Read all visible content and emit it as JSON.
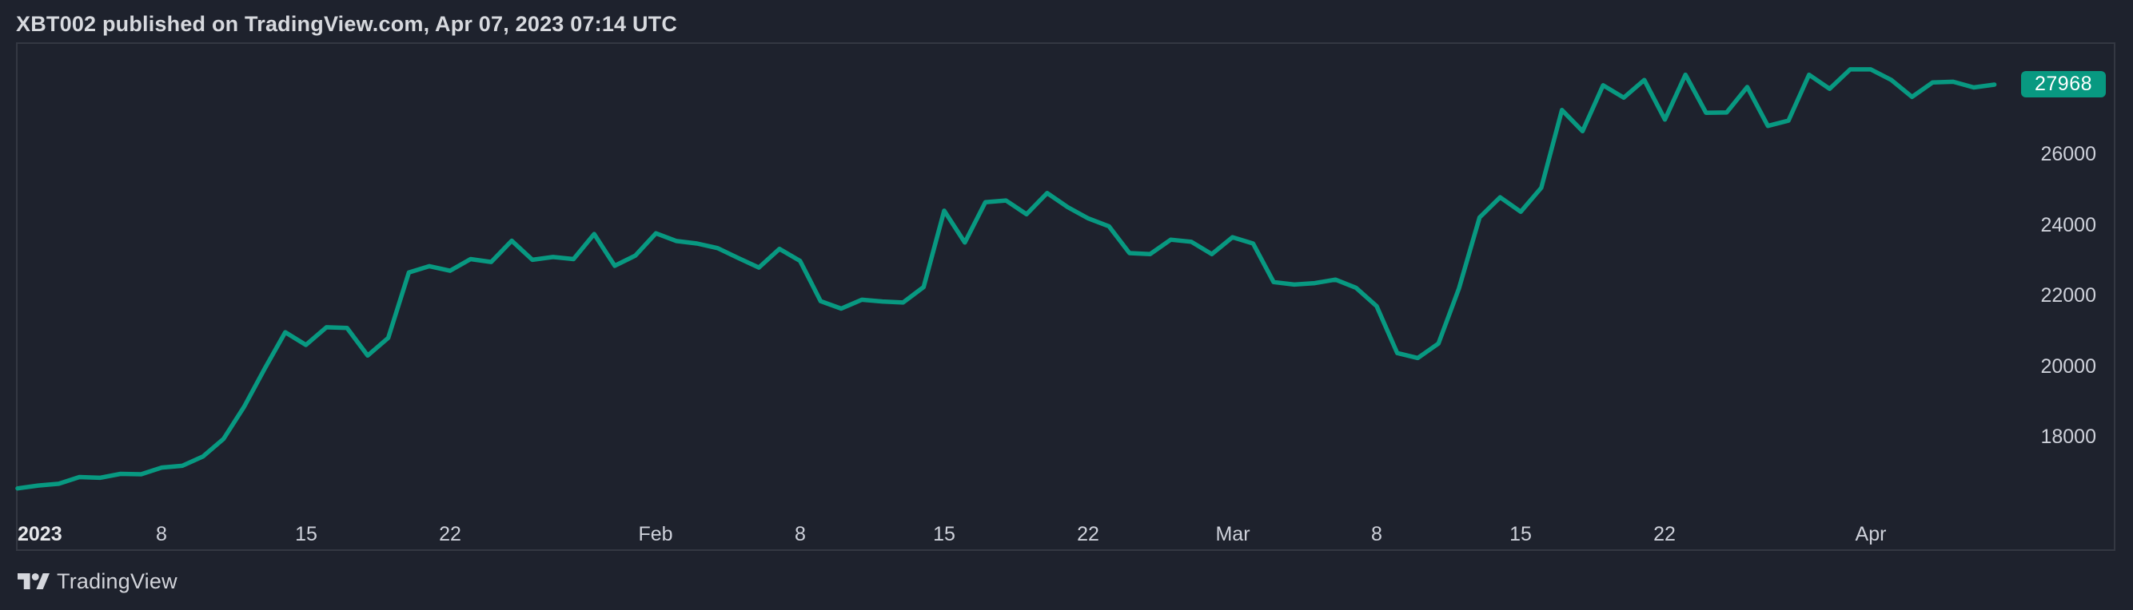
{
  "header": {
    "title": "XBT002 published on TradingView.com, Apr 07, 2023 07:14 UTC"
  },
  "price_label": {
    "value": "27968"
  },
  "footer": {
    "brand": "TradingView",
    "logo_icon": "tradingview-logo"
  },
  "colors": {
    "accent": "#089981",
    "background": "#1e222d",
    "border": "#343842",
    "axis_text": "#ced1da",
    "title_text": "#d7d9de",
    "badge_text": "#ffffff"
  },
  "chart_data": {
    "type": "line",
    "title": "XBT002 published on TradingView.com, Apr 07, 2023 07:14 UTC",
    "symbol": "XBT002",
    "timeframe": "1D",
    "x_start_date": "2023-01-01",
    "x_end_date": "2023-04-07",
    "last_price": 27968,
    "line_color": "#089981",
    "grid": false,
    "legend_position": "none",
    "y_ticks": [
      26000,
      24000,
      22000,
      20000,
      18000
    ],
    "ylim": [
      14700,
      29200
    ],
    "x_ticks": [
      {
        "label": "2023",
        "day": 0,
        "bold": true,
        "align": "left"
      },
      {
        "label": "8",
        "day": 7
      },
      {
        "label": "15",
        "day": 14
      },
      {
        "label": "22",
        "day": 21
      },
      {
        "label": "Feb",
        "day": 31
      },
      {
        "label": "8",
        "day": 38
      },
      {
        "label": "15",
        "day": 45
      },
      {
        "label": "22",
        "day": 52
      },
      {
        "label": "Mar",
        "day": 59
      },
      {
        "label": "8",
        "day": 66
      },
      {
        "label": "15",
        "day": 73
      },
      {
        "label": "22",
        "day": 80
      },
      {
        "label": "Apr",
        "day": 90
      }
    ],
    "values": [
      16540,
      16620,
      16670,
      16860,
      16840,
      16950,
      16940,
      17130,
      17180,
      17440,
      17940,
      18850,
      19930,
      20960,
      20600,
      21100,
      21080,
      20300,
      20800,
      22650,
      22830,
      22700,
      23030,
      22950,
      23550,
      23010,
      23090,
      23030,
      23740,
      22840,
      23130,
      23760,
      23540,
      23470,
      23340,
      23060,
      22790,
      23320,
      22980,
      21840,
      21630,
      21880,
      21830,
      21800,
      22240,
      24400,
      23500,
      24640,
      24690,
      24300,
      24900,
      24500,
      24180,
      23960,
      23200,
      23170,
      23580,
      23520,
      23170,
      23650,
      23470,
      22380,
      22310,
      22350,
      22450,
      22220,
      21700,
      20370,
      20230,
      20640,
      22200,
      24210,
      24780,
      24370,
      25050,
      27250,
      26650,
      27950,
      27600,
      28100,
      26980,
      28250,
      27170,
      27180,
      27900,
      26800,
      26950,
      28250,
      27850,
      28400,
      28400,
      28100,
      27620,
      28030,
      28050,
      27890,
      27968
    ]
  }
}
